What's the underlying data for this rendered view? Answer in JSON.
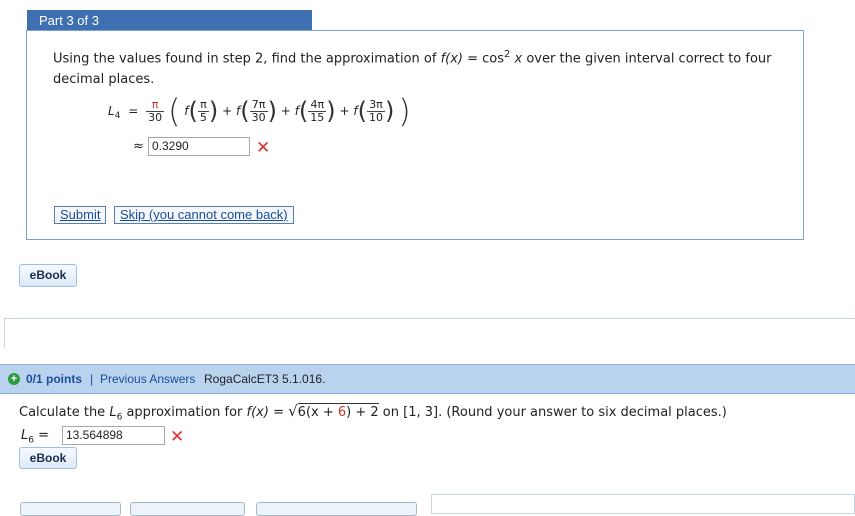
{
  "part": {
    "title": "Part 3 of 3",
    "question": "Using the values found in step 2, find the approximation of f(x) = cos² x over the given interval correct to four decimal places.",
    "q_prefix": "Using the values found in step 2, find the approximation of ",
    "q_fx": "f(x)",
    "q_eq": " = cos",
    "q_sup": "2",
    "q_x": " x",
    "q_suffix": " over the given interval correct to four decimal places.",
    "formula": {
      "lhs": "L",
      "lhs_sub": "4",
      "eq": "=",
      "coef_num": "π",
      "coef_den": "30",
      "f": "f",
      "plus": "+",
      "terms": [
        {
          "num": "π",
          "den": "5"
        },
        {
          "num": "7π",
          "den": "30"
        },
        {
          "num": "4π",
          "den": "15"
        },
        {
          "num": "3π",
          "den": "10"
        }
      ]
    },
    "approx_symbol": "≈",
    "answer_value": "0.3290",
    "answer_status": "incorrect",
    "submit_label": "Submit",
    "skip_label": "Skip (you cannot come back)",
    "ebook_label": "eBook"
  },
  "question2": {
    "points": "0/1 points",
    "separator": "|",
    "previous_answers": "Previous Answers",
    "code": "RogaCalcET3 5.1.016.",
    "text_prefix": "Calculate the ",
    "L": "L",
    "L_sub": "6",
    "text_mid": " approximation for ",
    "fx": "f(x)",
    "eq": " = ",
    "sqrt_inner_a": "6(x + ",
    "sqrt_inner_b": "6",
    "sqrt_inner_c": ")",
    "plus2": " + 2",
    "on": " on ",
    "interval": "[1, 3]",
    "instruction": ".  (Round your answer to six decimal places.)",
    "answer_label": "L",
    "answer_label_sub": "6",
    "answer_eq": "=",
    "answer_value": "13.564898",
    "answer_status": "incorrect",
    "ebook_label": "eBook"
  },
  "colors": {
    "part_header_bg": "#3d6fb1",
    "box_border": "#7da2cf",
    "q2_bar_bg": "#b9d3ee",
    "incorrect_mark": "#e0302b",
    "link": "#1a4e9a"
  },
  "icons": {
    "incorrect": "x-mark-icon",
    "points": "plus-circle-icon"
  }
}
